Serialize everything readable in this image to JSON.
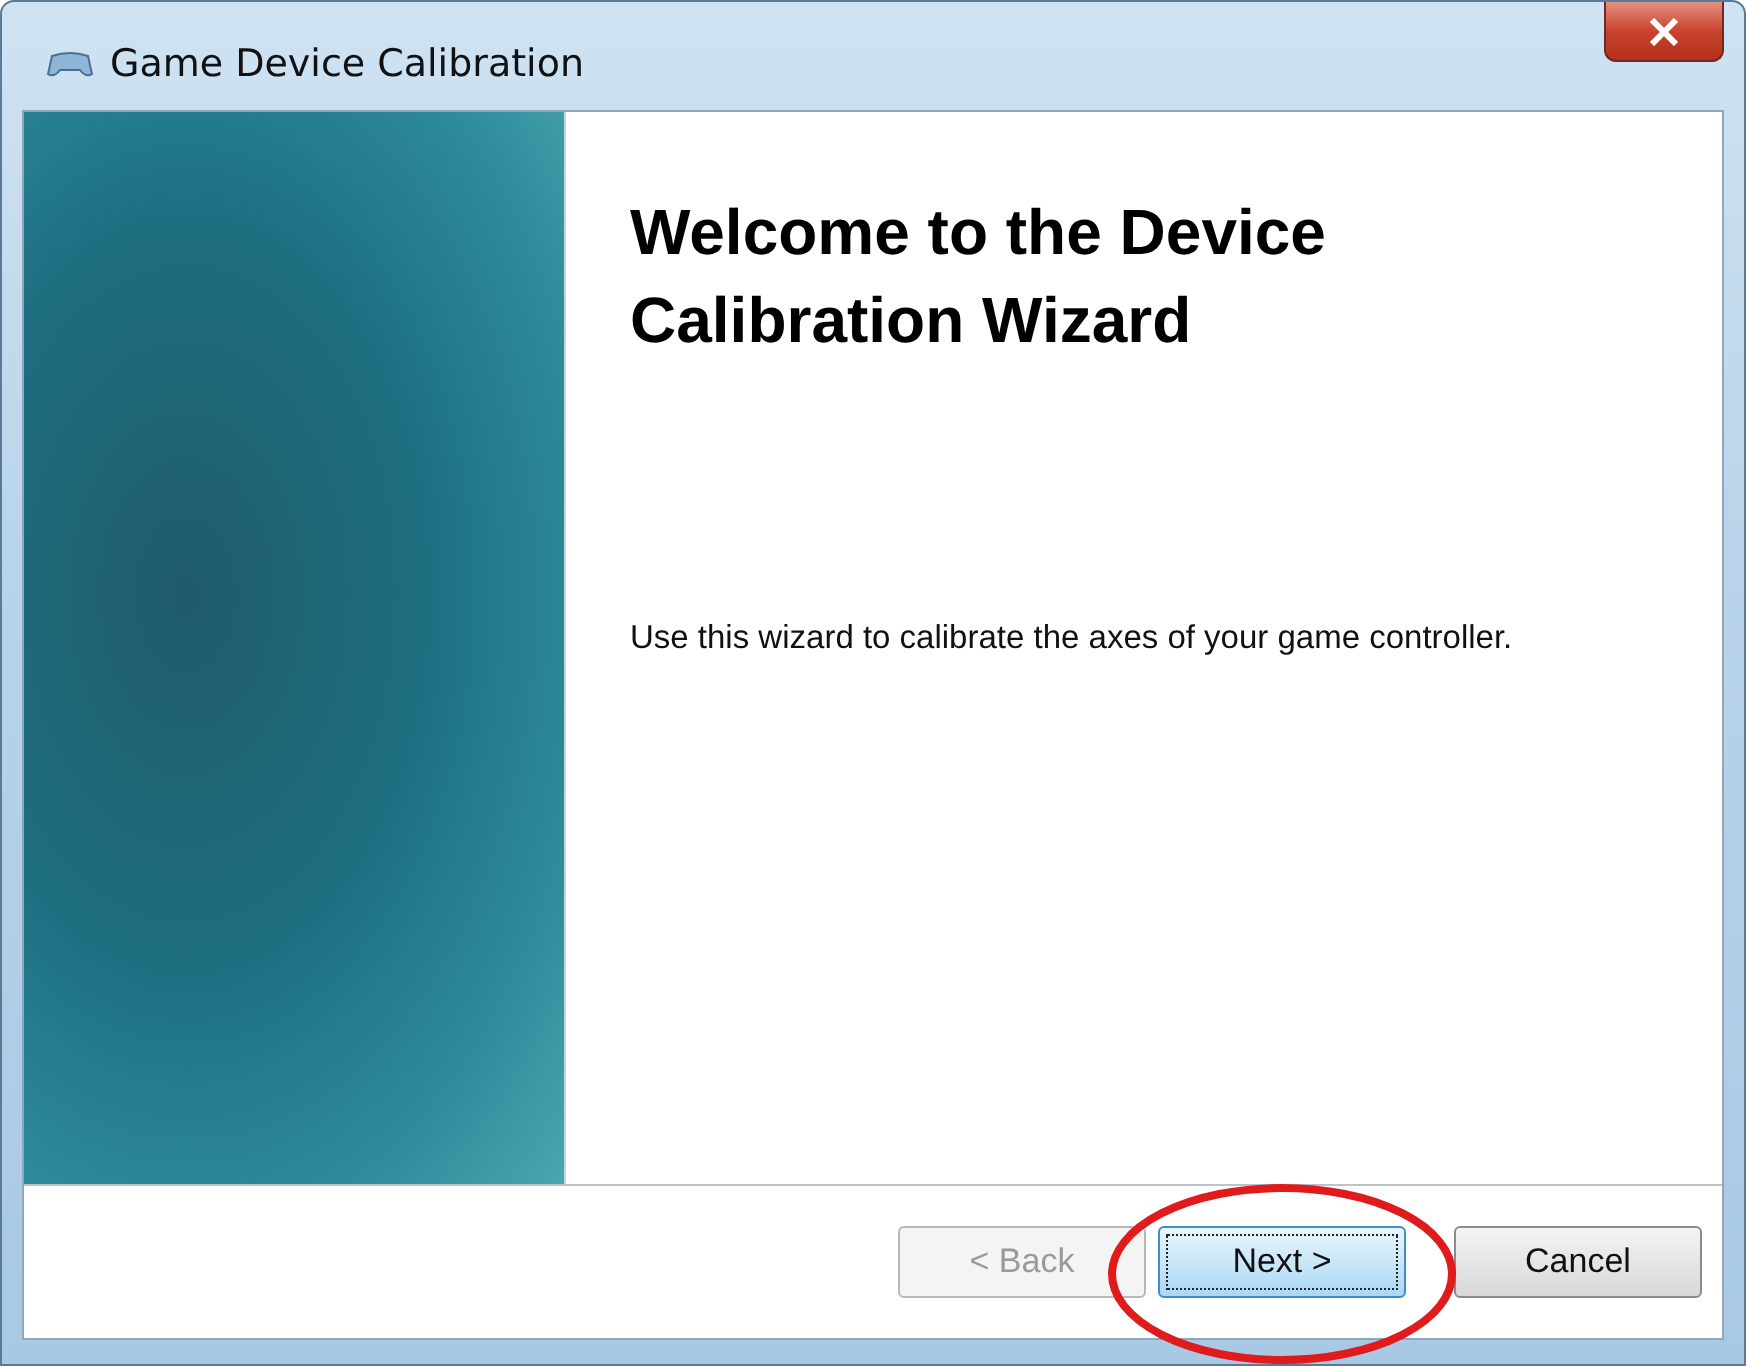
{
  "window": {
    "title": "Game Device Calibration"
  },
  "heading": "Welcome to the Device Calibration Wizard",
  "description": "Use this wizard to calibrate the axes of your game controller.",
  "buttons": [
    {
      "label": "< Back",
      "disabled": true,
      "focused": false
    },
    {
      "label": "Next >",
      "disabled": false,
      "focused": true
    },
    {
      "label": "Cancel",
      "disabled": false,
      "focused": false
    }
  ]
}
